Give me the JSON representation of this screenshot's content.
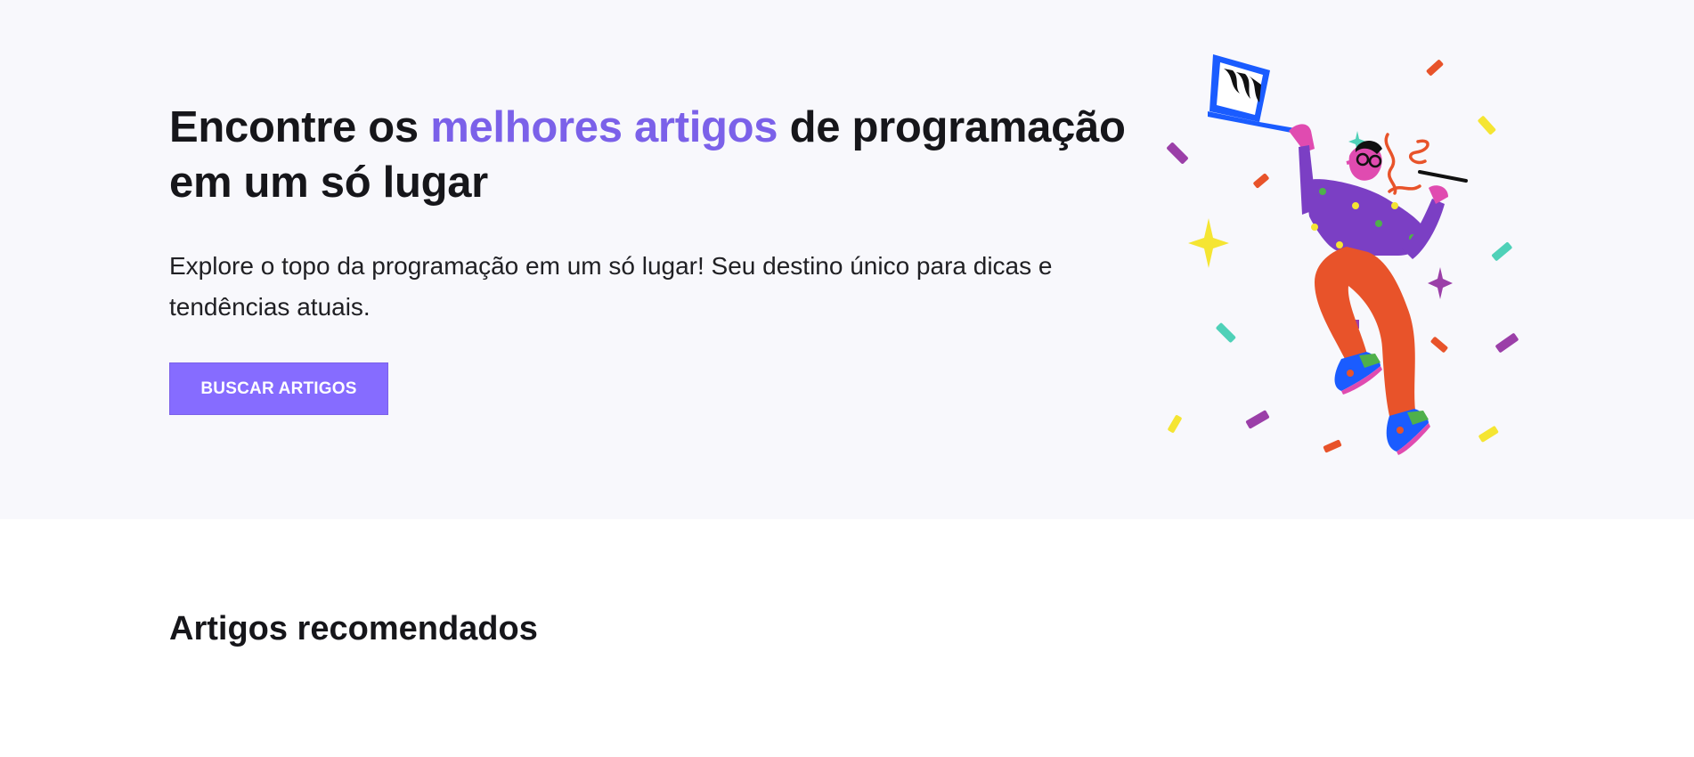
{
  "hero": {
    "title_before": "Encontre os ",
    "title_accent": "melhores artigos",
    "title_after": " de programação em um só lugar",
    "description": "Explore o topo da programação em um só lugar! Seu destino único para dicas e tendências atuais.",
    "cta_label": "BUSCAR ARTIGOS",
    "illustration": "person-jumping-with-laptop-illustration"
  },
  "recommended": {
    "title": "Artigos recomendados"
  },
  "colors": {
    "accent": "#7b61e9",
    "button": "#866cff",
    "hero_background": "#f8f8fc",
    "text": "#16161a"
  }
}
